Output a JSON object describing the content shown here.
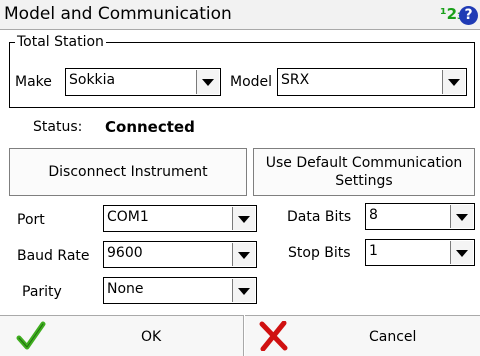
{
  "window": {
    "title": "Model and Communication",
    "input_mode_label": "¹2₃",
    "help_symbol": "?"
  },
  "total_station": {
    "legend": "Total Station",
    "make_label": "Make",
    "make_value": "Sokkia",
    "model_label": "Model",
    "model_value": "SRX"
  },
  "status": {
    "label": "Status:",
    "value": "Connected"
  },
  "actions": {
    "disconnect_label": "Disconnect Instrument",
    "use_default_label_line1": "Use Default Communication",
    "use_default_label_line2": "Settings"
  },
  "settings": {
    "port_label": "Port",
    "port_value": "COM1",
    "baud_label": "Baud Rate",
    "baud_value": "9600",
    "parity_label": "Parity",
    "parity_value": "None",
    "data_bits_label": "Data Bits",
    "data_bits_value": "8",
    "stop_bits_label": "Stop Bits",
    "stop_bits_value": "1"
  },
  "footer": {
    "ok_label": "OK",
    "cancel_label": "Cancel"
  },
  "colors": {
    "ok_check": "#3fae1f",
    "cancel_x": "#d01010",
    "help": "#1f3bb5"
  },
  "icons": {
    "ok": "checkmark-icon",
    "cancel": "red-x-icon",
    "help": "help-icon",
    "keyboard": "numeric-input-icon"
  }
}
